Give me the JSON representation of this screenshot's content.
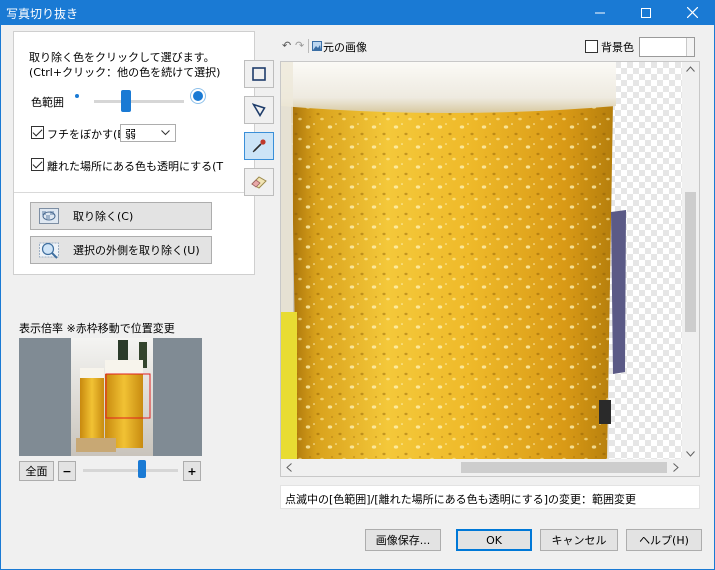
{
  "window": {
    "title": "写真切り抜き"
  },
  "panel": {
    "instruction_line1": "取り除く色をクリックして選びます。",
    "instruction_line2": "(Ctrl+クリック：他の色を続けて選択)",
    "color_range_label": "色範囲",
    "color_range_level": 0.35,
    "feather_label": "フチをぼかす(B",
    "feather_checked": true,
    "feather_value": "弱",
    "remote_label": "離れた場所にある色も透明にする(T",
    "remote_checked": true,
    "remove_button": "取り除く(C)",
    "remove_outside_button": "選択の外側を取り除く(U)"
  },
  "tools": [
    "rectangle-select-icon",
    "polygon-select-icon",
    "eyedropper-icon",
    "eraser-icon"
  ],
  "zoom": {
    "label": "表示倍率 ※赤枠移動で位置変更",
    "fit_button": "全面",
    "minus": "−",
    "plus": "+",
    "level": 0.62
  },
  "viewer_toolbar": {
    "original_label": "元の画像",
    "bg_color_label": "背景色",
    "bg_color_checked": false
  },
  "status_text": "点滅中の[色範囲]/[離れた場所にある色も透明にする]の変更：範囲変更",
  "buttons": {
    "save": "画像保存...",
    "ok": "OK",
    "cancel": "キャンセル",
    "help": "ヘルプ(H)"
  },
  "colors": {
    "accent": "#1a7ad4",
    "beer": "#e0a81c",
    "foam": "#f7f3ea"
  }
}
